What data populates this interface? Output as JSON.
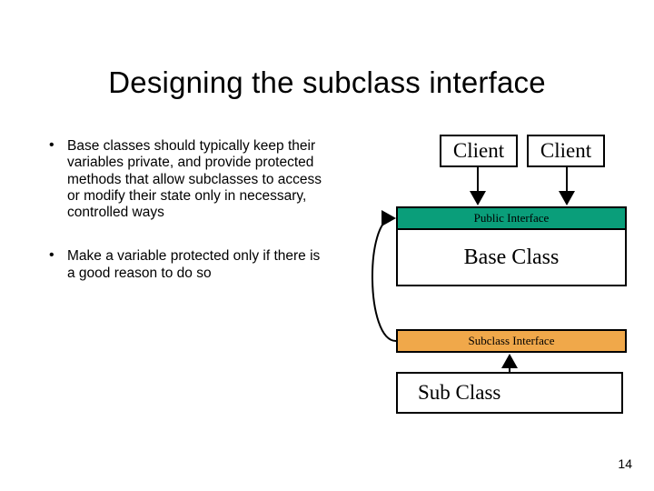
{
  "title": "Designing the subclass interface",
  "bullets": [
    "Base classes should typically keep their variables private, and provide protected methods that allow subclasses to access or modify their state only in necessary, controlled ways",
    "Make a variable protected only if there is a good reason to do so"
  ],
  "diagram": {
    "client1": "Client",
    "client2": "Client",
    "public_interface": "Public Interface",
    "base_class": "Base Class",
    "subclass_interface": "Subclass Interface",
    "sub_class": "Sub Class"
  },
  "page_number": "14"
}
